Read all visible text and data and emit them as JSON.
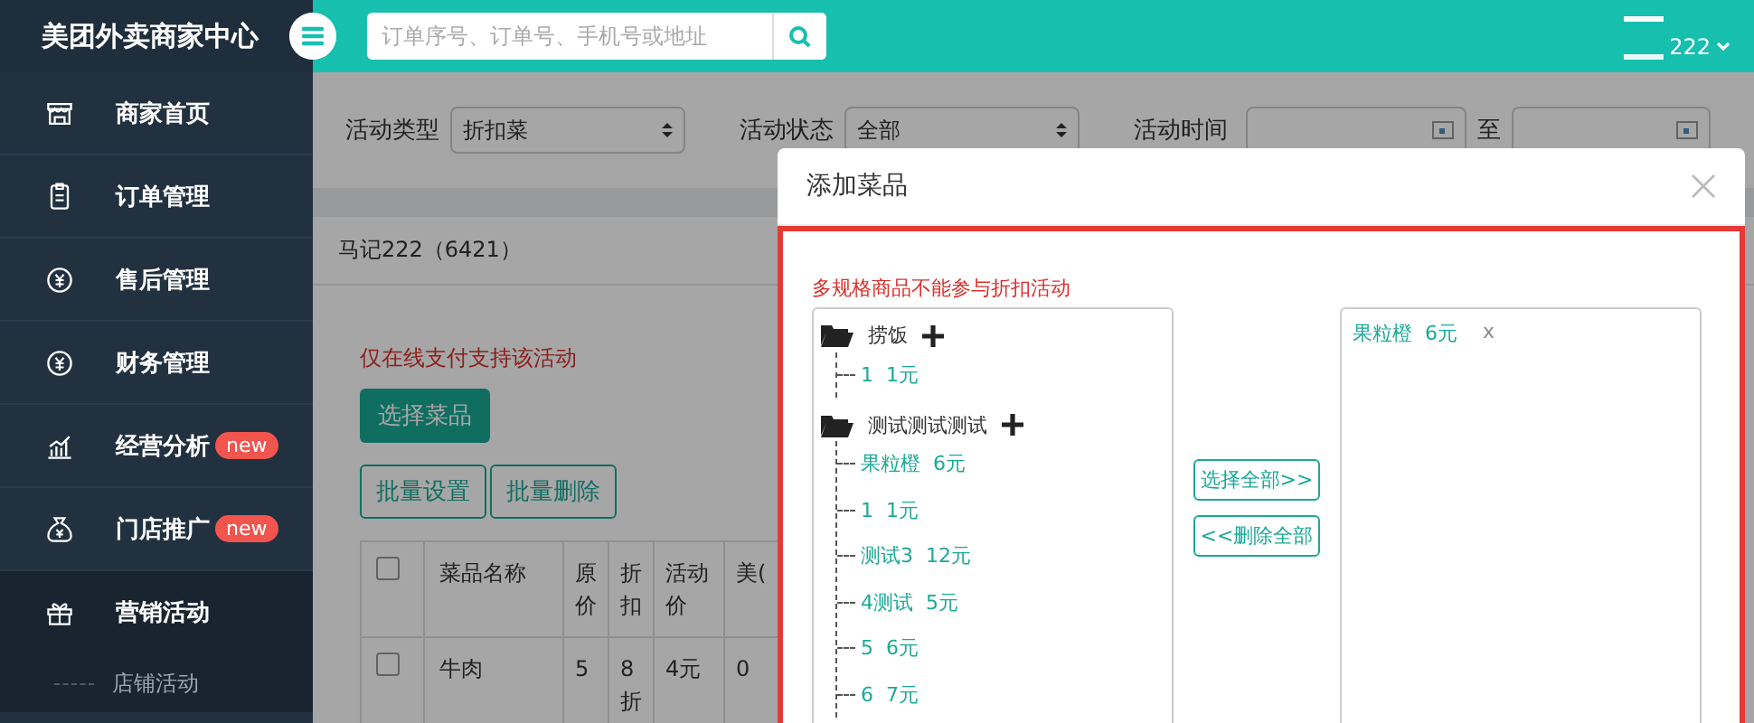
{
  "topbar": {
    "brand": "美团外卖商家中心",
    "search": {
      "placeholder": "订单序号、订单号、手机号或地址"
    },
    "user": {
      "name": "222"
    }
  },
  "sidebar": {
    "items": [
      {
        "label": "商家首页",
        "selected": false
      },
      {
        "label": "订单管理",
        "selected": false
      },
      {
        "label": "售后管理",
        "selected": false
      },
      {
        "label": "财务管理",
        "selected": false
      },
      {
        "label": "经营分析",
        "badge": "new",
        "selected": false
      },
      {
        "label": "门店推广",
        "badge": "new",
        "selected": false
      },
      {
        "label": "营销活动",
        "selected": true,
        "children": [
          {
            "label": "店铺活动",
            "selected": false
          }
        ]
      }
    ]
  },
  "filters": {
    "type": {
      "label": "活动类型",
      "value": "折扣菜"
    },
    "status": {
      "label": "活动状态",
      "value": "全部"
    },
    "time": {
      "label": "活动时间",
      "separator": "至"
    }
  },
  "store_title": "马记222（6421）",
  "notice": "仅在线支付支持该活动",
  "select_button": "选择菜品",
  "batch_buttons": [
    "批量设置",
    "批量删除"
  ],
  "table": {
    "columns": [
      "菜品名称",
      "原价",
      "折扣",
      "活动价",
      "美("
    ],
    "header_checked": false,
    "rows": [
      {
        "checked": false,
        "cells": [
          "牛肉",
          "5",
          "8折",
          "4元",
          "0"
        ]
      }
    ]
  },
  "modal": {
    "title": "添加菜品",
    "notice": "多规格商品不能参与折扣活动",
    "tree": [
      {
        "label": "捞饭",
        "children": [
          {
            "name": "1",
            "price": "1元"
          }
        ]
      },
      {
        "label": "测试测试测试",
        "children": [
          {
            "name": "果粒橙",
            "price": "6元"
          },
          {
            "name": "1",
            "price": "1元"
          },
          {
            "name": "测试3",
            "price": "12元"
          },
          {
            "name": "4测试",
            "price": "5元"
          },
          {
            "name": "5",
            "price": "6元"
          },
          {
            "name": "6",
            "price": "7元"
          }
        ]
      }
    ],
    "select_all": "选择全部>>",
    "remove_all": "<<删除全部",
    "chosen": [
      {
        "name": "果粒橙",
        "price": "6元",
        "remove": "x"
      }
    ]
  }
}
